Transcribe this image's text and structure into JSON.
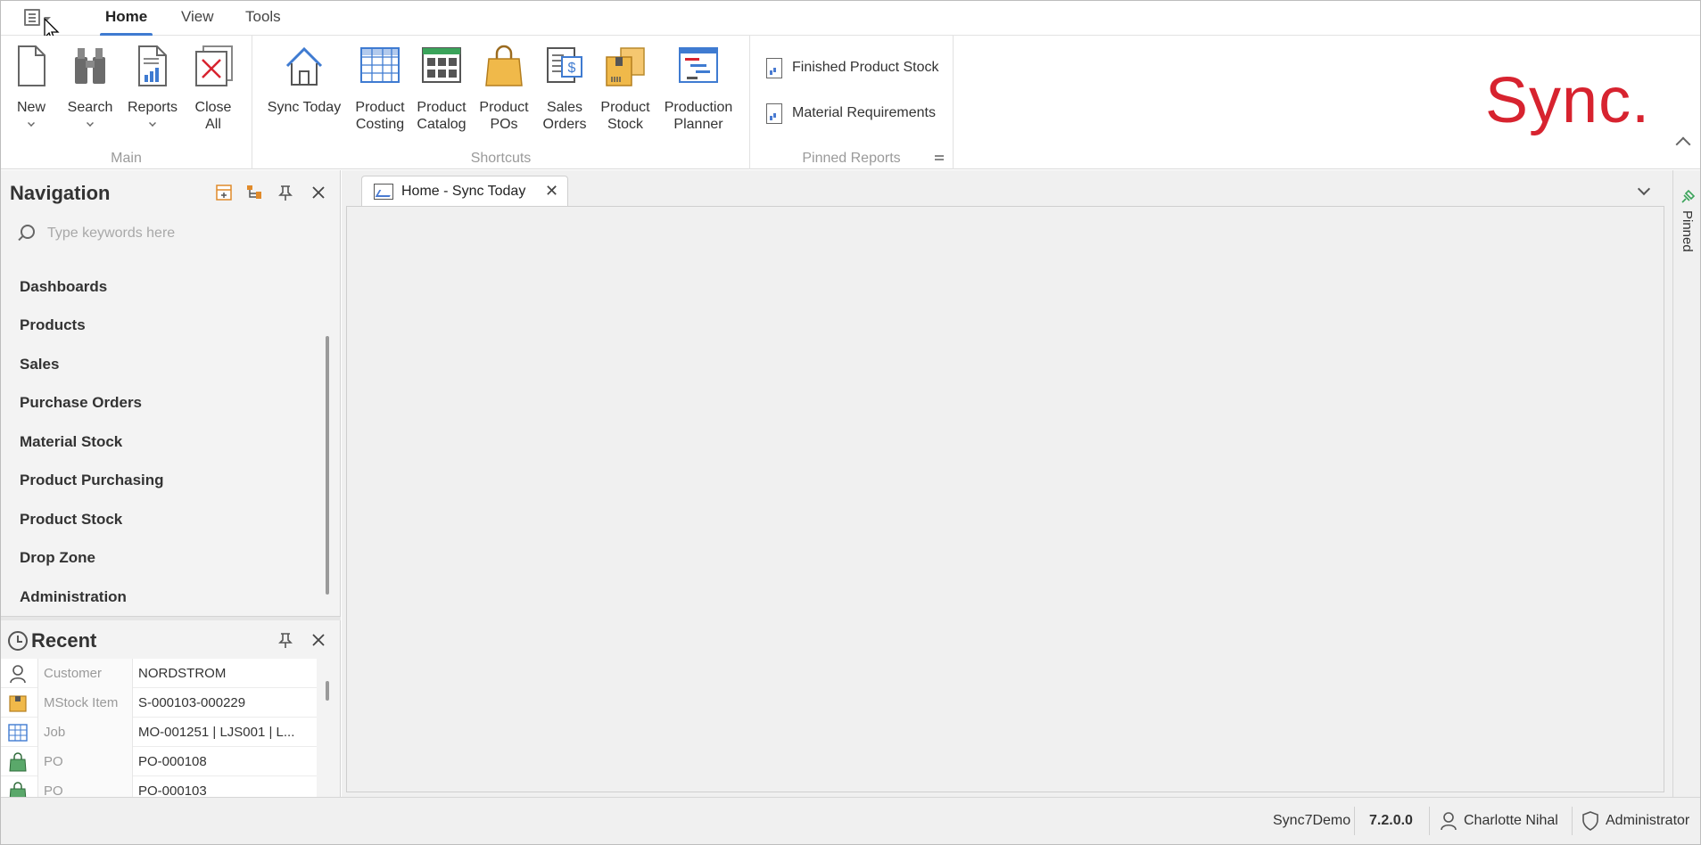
{
  "ribbon": {
    "tabs": [
      {
        "label": "Home",
        "active": true
      },
      {
        "label": "View",
        "active": false
      },
      {
        "label": "Tools",
        "active": false
      }
    ],
    "groups": {
      "main": {
        "label": "Main",
        "buttons": [
          "New",
          "Search",
          "Reports",
          "Close\nAll"
        ]
      },
      "shortcuts": {
        "label": "Shortcuts",
        "buttons": [
          "Sync Today",
          "Product\nCosting",
          "Product\nCatalog",
          "Product\nPOs",
          "Sales\nOrders",
          "Product\nStock",
          "Production\nPlanner"
        ]
      },
      "pinned_reports": {
        "label": "Pinned Reports",
        "items": [
          "Finished Product Stock",
          "Material Requirements"
        ]
      }
    },
    "logo": "Sync."
  },
  "navigation": {
    "title": "Navigation",
    "search_placeholder": "Type keywords here",
    "items": [
      "Dashboards",
      "Products",
      "Sales",
      "Purchase Orders",
      "Material Stock",
      "Product Purchasing",
      "Product Stock",
      "Drop Zone",
      "Administration"
    ]
  },
  "recent": {
    "title": "Recent",
    "rows": [
      {
        "type": "Customer",
        "value": "NORDSTROM",
        "icon": "customer-icon"
      },
      {
        "type": "MStock Item",
        "value": "S-000103-000229",
        "icon": "box-icon"
      },
      {
        "type": "Job",
        "value": "MO-001251 | LJS001 | L...",
        "icon": "grid-icon"
      },
      {
        "type": "PO",
        "value": "PO-000108",
        "icon": "bag-icon"
      },
      {
        "type": "PO",
        "value": "PO-000103",
        "icon": "bag-icon"
      }
    ]
  },
  "document": {
    "tab_label": "Home - Sync Today"
  },
  "pinned": {
    "label": "Pinned"
  },
  "status": {
    "database": "Sync7Demo",
    "version": "7.2.0.0",
    "user": "Charlotte Nihal",
    "role": "Administrator"
  },
  "colors": {
    "accent": "#3f7bd1",
    "brand": "#d7232f"
  }
}
